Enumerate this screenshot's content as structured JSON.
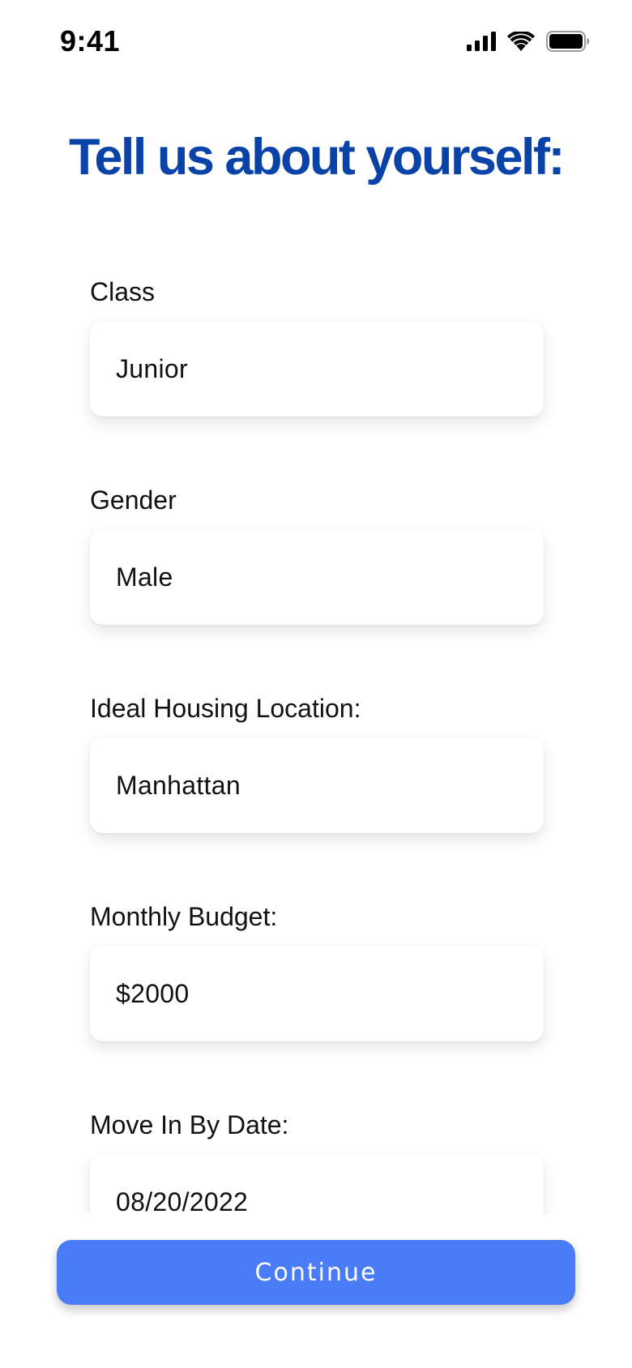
{
  "status_bar": {
    "time": "9:41",
    "icons": [
      "cellular-signal-icon",
      "wifi-icon",
      "battery-icon"
    ]
  },
  "header": {
    "title": "Tell us about yourself:"
  },
  "form": {
    "fields": [
      {
        "label": "Class",
        "value": "Junior"
      },
      {
        "label": "Gender",
        "value": "Male"
      },
      {
        "label": "Ideal Housing Location:",
        "value": "Manhattan"
      },
      {
        "label": "Monthly Budget:",
        "value": "$2000"
      },
      {
        "label": "Move In By Date:",
        "value": "08/20/2022"
      }
    ]
  },
  "actions": {
    "continue_label": "Continue"
  },
  "colors": {
    "title": "#0a43a8",
    "primary_button": "#4a7cf7",
    "background": "#ffffff"
  }
}
